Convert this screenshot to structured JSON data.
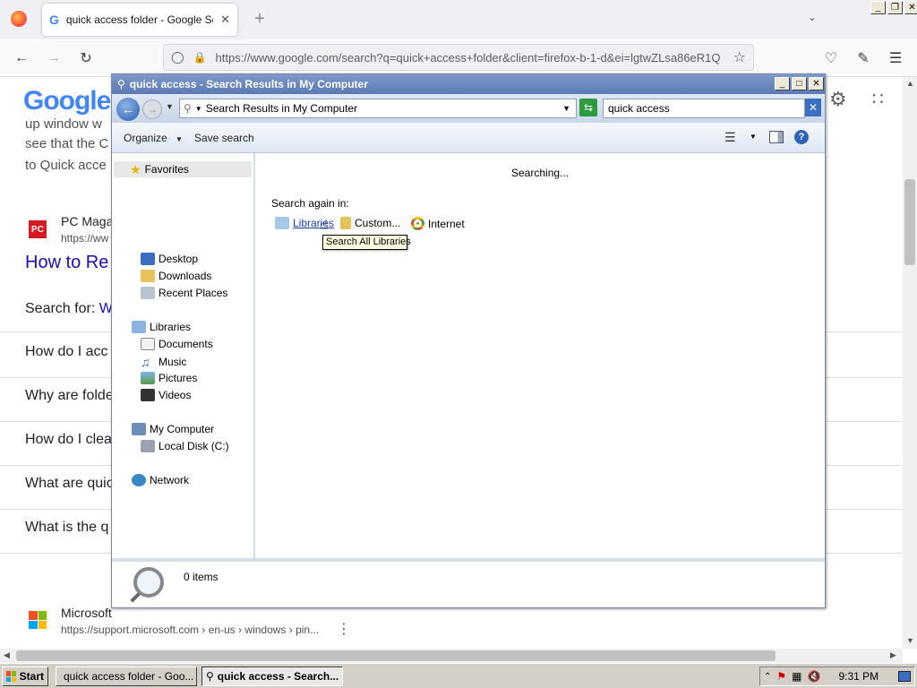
{
  "firefox": {
    "tab_title": "quick access folder - Google Search",
    "url": "https://www.google.com/search?q=quick+access+folder&client=firefox-b-1-d&ei=lgtwZLsa86eR1Q"
  },
  "google": {
    "logo": "Google",
    "snippet_lines": [
      "up window w",
      "see that the C",
      "to Quick acce"
    ],
    "result1": {
      "site": "PC Maga",
      "url": "https://ww",
      "title": "How to Re"
    },
    "search_for_label": "Search for:",
    "search_for_link": "W",
    "questions": [
      "How do I acc",
      "Why are folde",
      "How do I clea",
      "What are quic",
      "What is the q"
    ],
    "result2": {
      "site": "Microsoft",
      "url": "https://support.microsoft.com › en-us › windows › pin..."
    }
  },
  "explorer": {
    "title": "quick access - Search Results in My Computer",
    "address": "Search Results in My Computer",
    "search_value": "quick access",
    "commands": {
      "organize": "Organize",
      "save_search": "Save search"
    },
    "nav": {
      "favorites": "Favorites",
      "desktop": "Desktop",
      "downloads": "Downloads",
      "recent_places": "Recent Places",
      "libraries": "Libraries",
      "documents": "Documents",
      "music": "Music",
      "pictures": "Pictures",
      "videos": "Videos",
      "my_computer": "My Computer",
      "local_disk": "Local Disk (C:)",
      "network": "Network"
    },
    "content": {
      "status": "Searching...",
      "search_again_label": "Search again in:",
      "options": {
        "libraries": "Libraries",
        "custom": "Custom...",
        "internet": "Internet"
      },
      "tooltip": "Search All Libraries"
    },
    "details": {
      "items_count": "0 items"
    }
  },
  "taskbar": {
    "start": "Start",
    "tasks": [
      {
        "label": "quick access folder - Goo..."
      },
      {
        "label": "quick access - Search..."
      }
    ],
    "clock": "9:31 PM"
  }
}
